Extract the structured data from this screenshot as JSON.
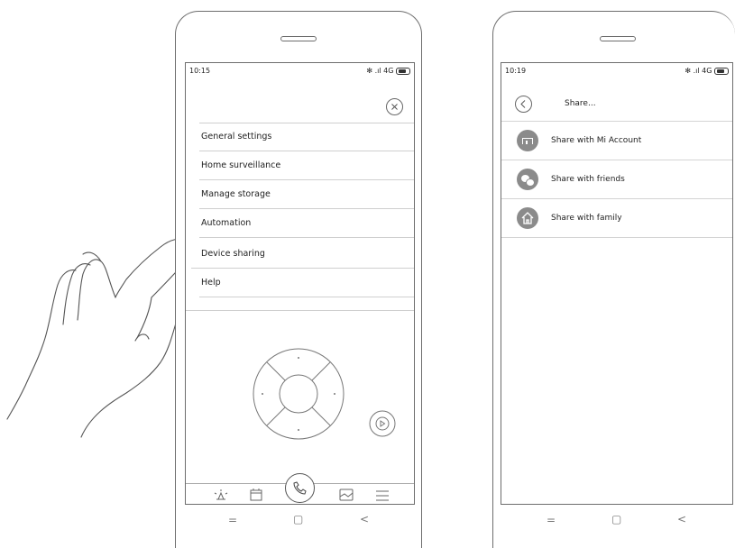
{
  "left_phone": {
    "status_time": "10:15",
    "status_icons": "✻ .ıl 4G",
    "menu_items": [
      {
        "label": "General settings"
      },
      {
        "label": "Home surveillance"
      },
      {
        "label": "Manage storage"
      },
      {
        "label": "Automation"
      },
      {
        "label": "Device sharing"
      },
      {
        "label": "Help"
      }
    ],
    "close_icon": "close-icon",
    "bottom_bar_icons": [
      "alarm-icon",
      "camera-roll-icon",
      "call-icon",
      "album-icon",
      "menu-icon"
    ],
    "nav_keys": [
      "=",
      "▢",
      "<"
    ]
  },
  "right_phone": {
    "status_time": "10:19",
    "status_icons": "✻ .ıl 4G",
    "header_title": "Share...",
    "share_items": [
      {
        "label": "Share with Mi Account",
        "icon": "mi-icon"
      },
      {
        "label": "Share with friends",
        "icon": "wechat-icon"
      },
      {
        "label": "Share with family",
        "icon": "home-icon"
      }
    ],
    "nav_keys": [
      "=",
      "▢",
      "<"
    ]
  },
  "colors": {
    "line": "#6d6d6d",
    "icon_circle": "#8b8b8b",
    "watermark": "#d8ecb8"
  }
}
